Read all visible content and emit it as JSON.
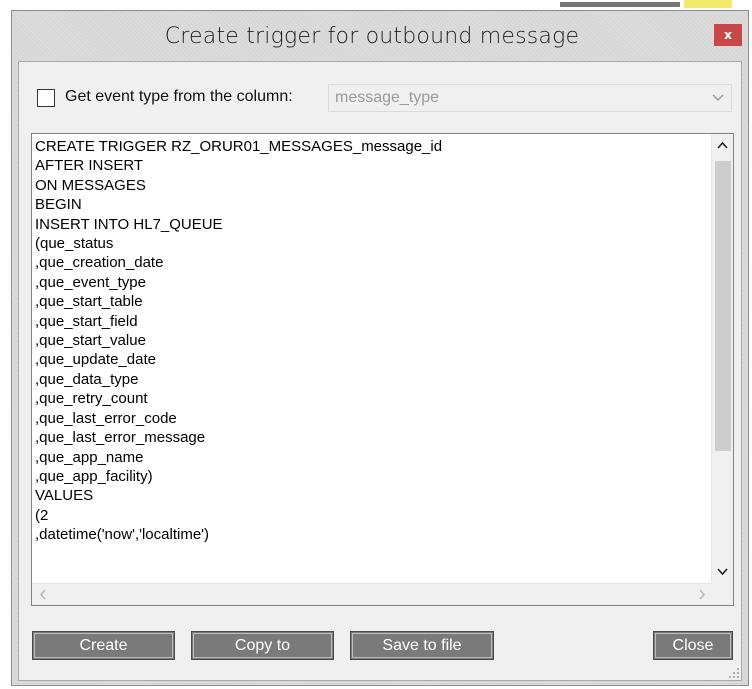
{
  "window": {
    "title": "Create trigger for outbound message",
    "close_glyph": "x",
    "accent_color": "#c74848"
  },
  "event_type": {
    "checkbox_label": "Get event type from the column:",
    "checked": false,
    "column_select_value": "message_type"
  },
  "editor": {
    "lines": [
      "CREATE TRIGGER RZ_ORUR01_MESSAGES_message_id",
      "AFTER INSERT",
      "ON MESSAGES",
      "BEGIN",
      "INSERT INTO HL7_QUEUE",
      "(que_status",
      ",que_creation_date",
      ",que_event_type",
      ",que_start_table",
      ",que_start_field",
      ",que_start_value",
      ",que_update_date",
      ",que_data_type",
      ",que_retry_count",
      ",que_last_error_code",
      ",que_last_error_message",
      ",que_app_name",
      ",que_app_facility)",
      "VALUES",
      "(2",
      ",datetime('now','localtime')"
    ]
  },
  "buttons": {
    "create": "Create",
    "copy_to": "Copy to",
    "save_to_file": "Save to file",
    "close": "Close"
  },
  "icons": {
    "close": "close-icon",
    "dropdown": "chevron-down-icon",
    "scroll_up": "chevron-up-icon",
    "scroll_down": "chevron-down-icon",
    "scroll_left": "chevron-left-icon",
    "scroll_right": "chevron-right-icon",
    "resize": "resize-grip-icon"
  }
}
